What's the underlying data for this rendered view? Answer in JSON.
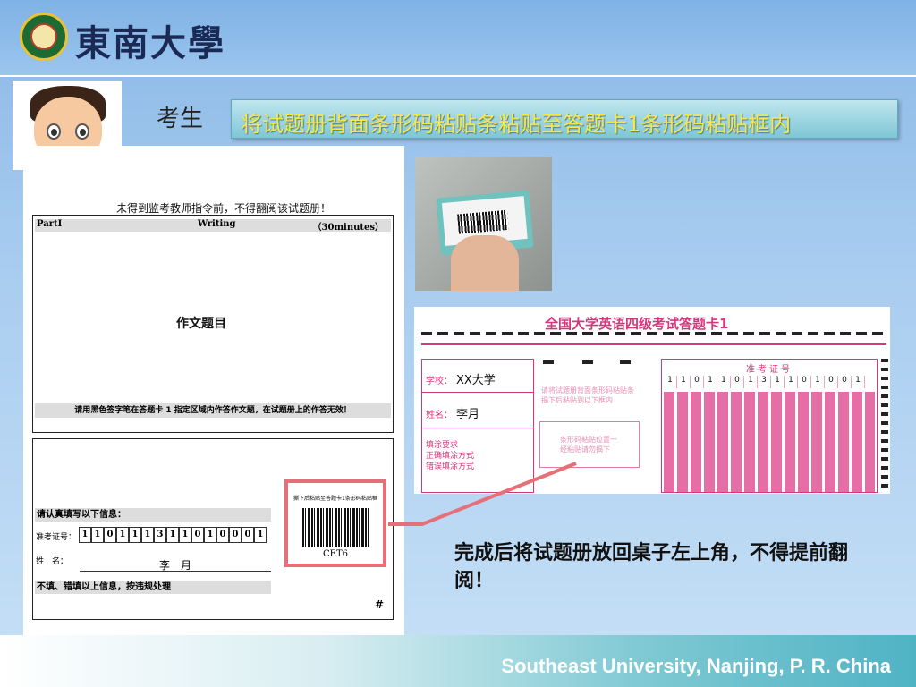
{
  "header": {
    "logo_text": "東南大學",
    "brand_color": "#1b2a55"
  },
  "student": {
    "label": "考生"
  },
  "banner": {
    "text": "将试题册背面条形码粘贴条粘贴至答题卡1条形码粘贴框内"
  },
  "booklet": {
    "notice": "未得到监考教师指令前，不得翻阅该试题册！",
    "part": "PartI",
    "section": "Writing",
    "time": "（30minutes）",
    "essay_title": "作文题目",
    "essay_footer": "请用黑色签字笔在答题卡 1 指定区域内作答作文题，在试题册上的作答无效！",
    "confirm_label": "请认真填写以下信息：",
    "admission_label": "准考证号：",
    "admission_digits": [
      "1",
      "1",
      "0",
      "1",
      "1",
      "1",
      "3",
      "1",
      "1",
      "0",
      "1",
      "0",
      "0",
      "0",
      "1"
    ],
    "name_label": "姓　名：",
    "name_value": "李　月",
    "warning": "不填、错填以上信息，按违规处理",
    "hash": "#"
  },
  "barcode": {
    "caption": "撕下后粘贴至答题卡1条形码粘贴框",
    "text": "CET6"
  },
  "answer_sheet": {
    "title": "全国大学英语四级考试答题卡1",
    "school_label": "学校：",
    "school_value": "XX大学",
    "name_label": "姓名：",
    "name_value": "李月",
    "fill_label": "填涂要求",
    "correct_label": "正确填涂方式",
    "wrong_label": "错误填涂方式",
    "paste_hint": "请将试题册背面条形码粘贴条揭下后粘贴到以下框内",
    "paste_box": "条形码粘贴位置一经粘贴请勿揭下",
    "exam_label": "准考证号",
    "exam_digits": [
      "1",
      "1",
      "0",
      "1",
      "1",
      "0",
      "1",
      "3",
      "1",
      "1",
      "0",
      "1",
      "0",
      "0",
      "1"
    ]
  },
  "completion_text": "完成后将试题册放回桌子左上角，不得提前翻阅！",
  "footer": {
    "text": "Southeast University, Nanjing, P. R. China"
  },
  "colors": {
    "highlight": "#e76f78",
    "sheet_accent": "#d6367b",
    "banner_text": "#f7e64a"
  }
}
